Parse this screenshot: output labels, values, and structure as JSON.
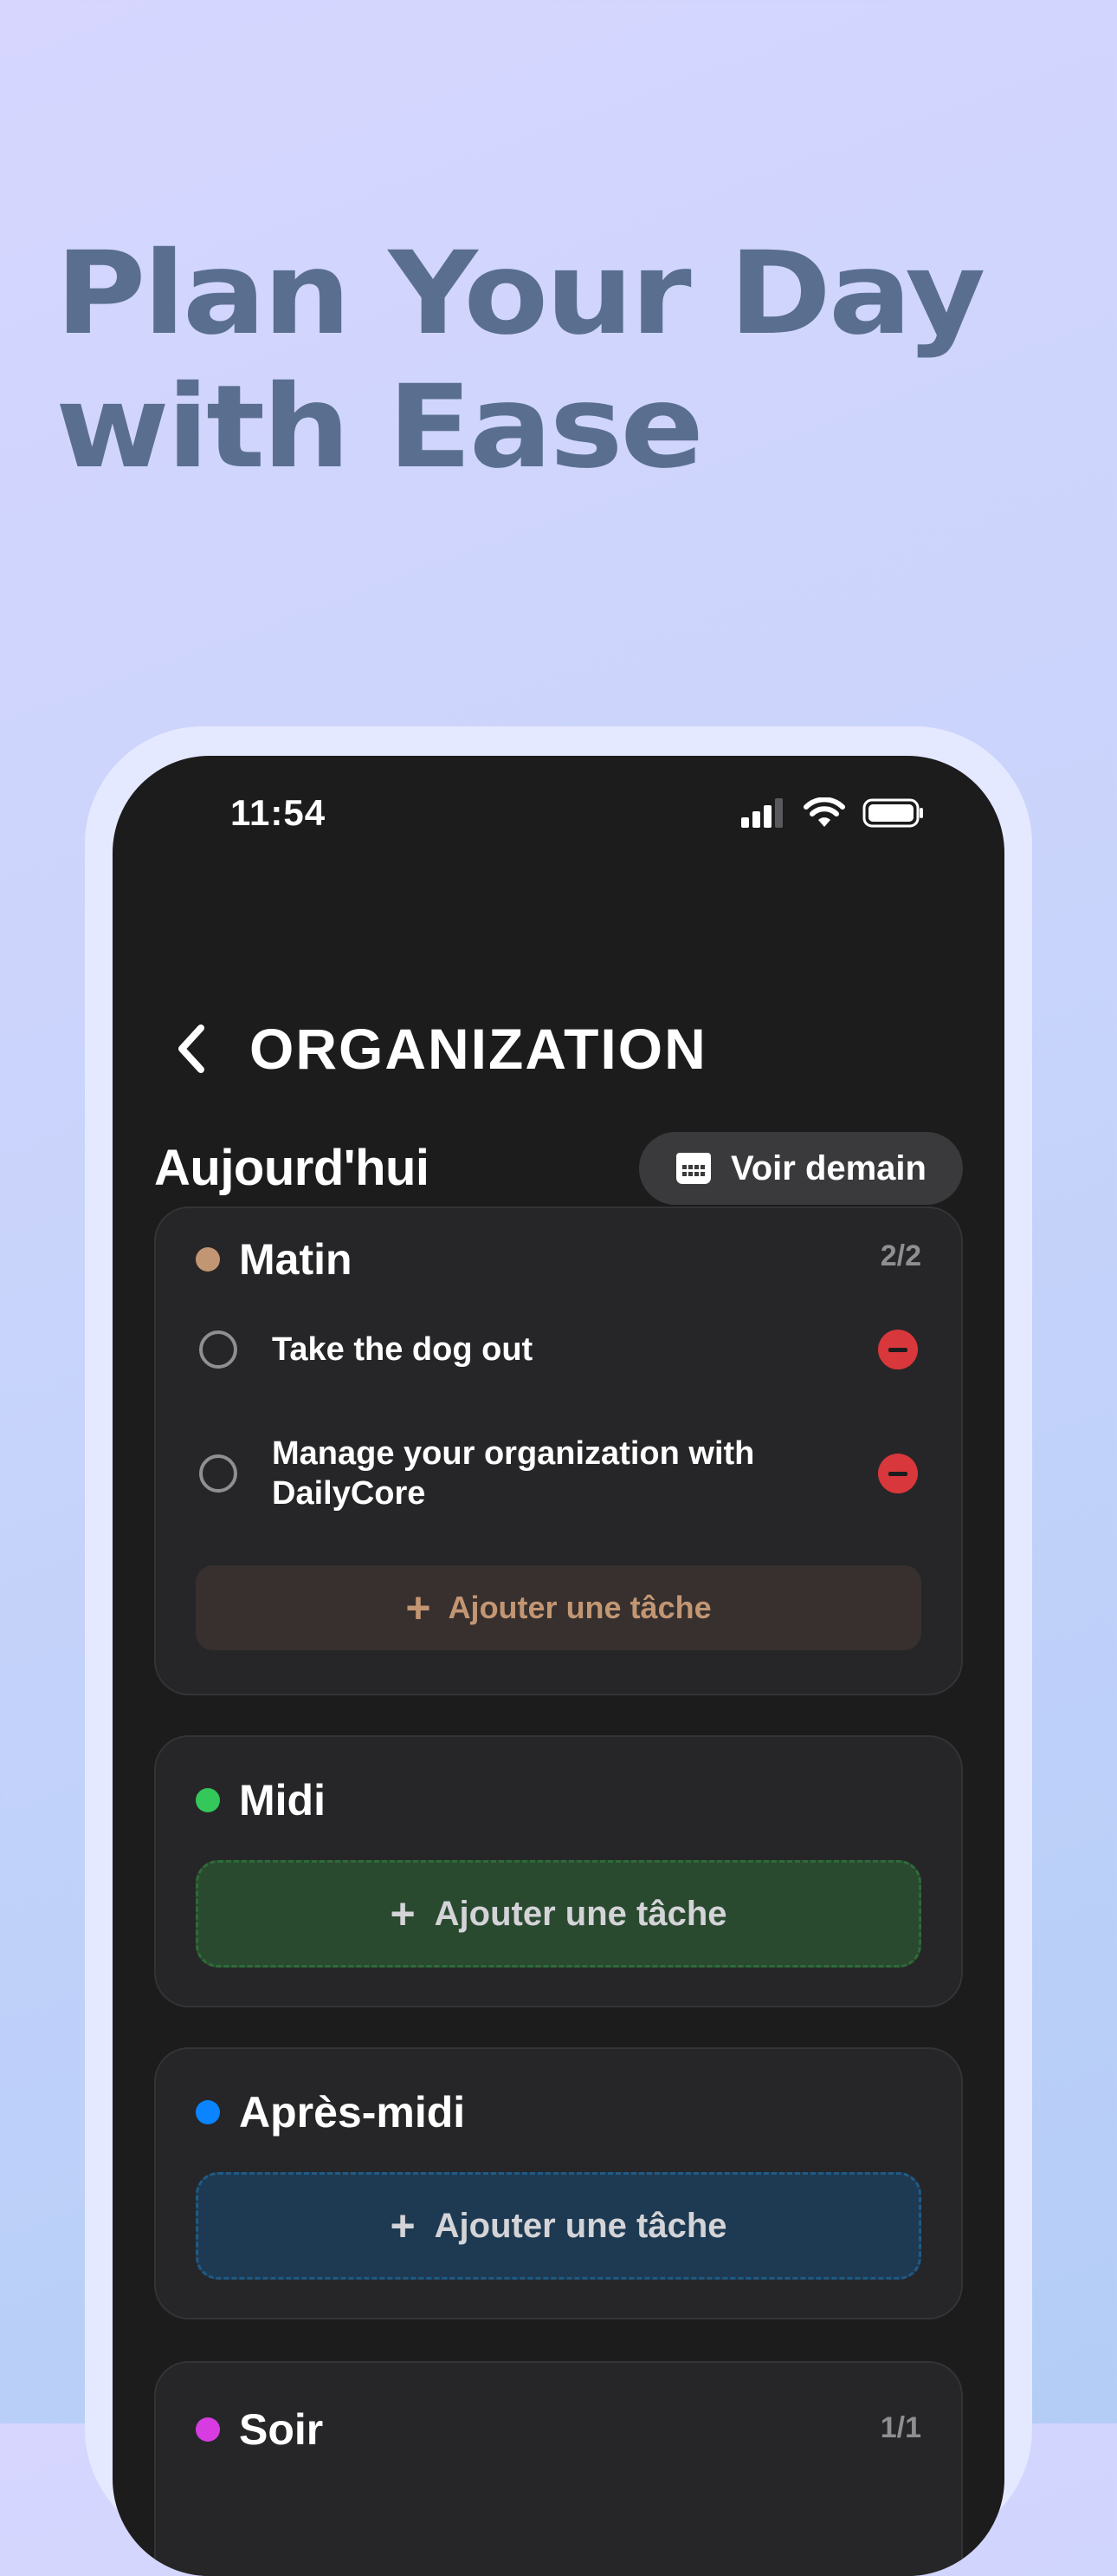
{
  "headline": {
    "line1": "Plan Your Day",
    "line2": "with Ease"
  },
  "status_bar": {
    "time": "11:54",
    "icons": [
      "cellular-signal-icon",
      "wifi-icon",
      "battery-icon"
    ]
  },
  "header": {
    "title": "ORGANIZATION",
    "back_icon": "chevron-left-icon"
  },
  "day": {
    "label": "Aujourd'hui",
    "next_button": "Voir demain",
    "next_icon": "calendar-icon"
  },
  "sections": [
    {
      "name": "Matin",
      "color": "#c39673",
      "count": "2/2",
      "tasks": [
        "Take the dog out",
        "Manage your organization with DailyCore"
      ],
      "add_label": "Ajouter une tâche"
    },
    {
      "name": "Midi",
      "color": "#34c759",
      "add_label": "Ajouter une tâche"
    },
    {
      "name": "Après-midi",
      "color": "#0a84ff",
      "add_label": "Ajouter une tâche"
    },
    {
      "name": "Soir",
      "color": "#d63ce0",
      "count": "1/1"
    }
  ]
}
